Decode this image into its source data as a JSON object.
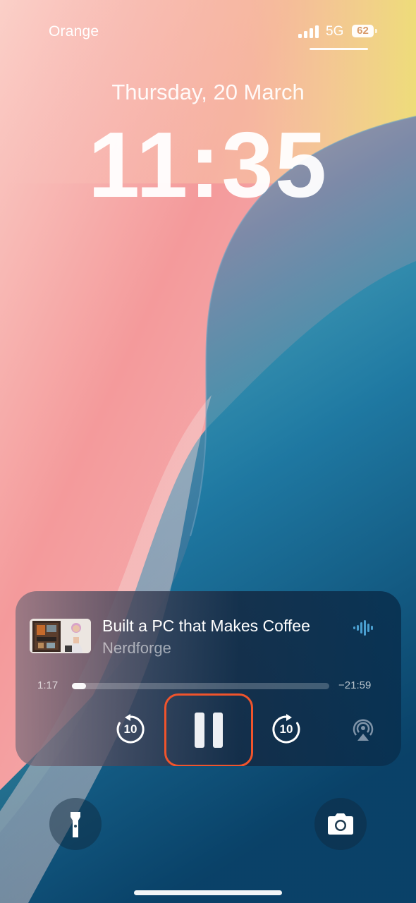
{
  "status_bar": {
    "carrier": "Orange",
    "network": "5G",
    "battery": "62"
  },
  "lock_screen": {
    "date": "Thursday, 20 March",
    "time": "11:35"
  },
  "now_playing": {
    "title": "Built a PC that Makes Coffee",
    "artist": "Nerdforge",
    "elapsed": "1:17",
    "remaining": "−21:59",
    "progress": 0.056,
    "skip_back_label": "10",
    "skip_forward_label": "10",
    "highlight_color": "#f0542c"
  },
  "quick_actions": {
    "left": "flashlight-icon",
    "right": "camera-icon"
  }
}
